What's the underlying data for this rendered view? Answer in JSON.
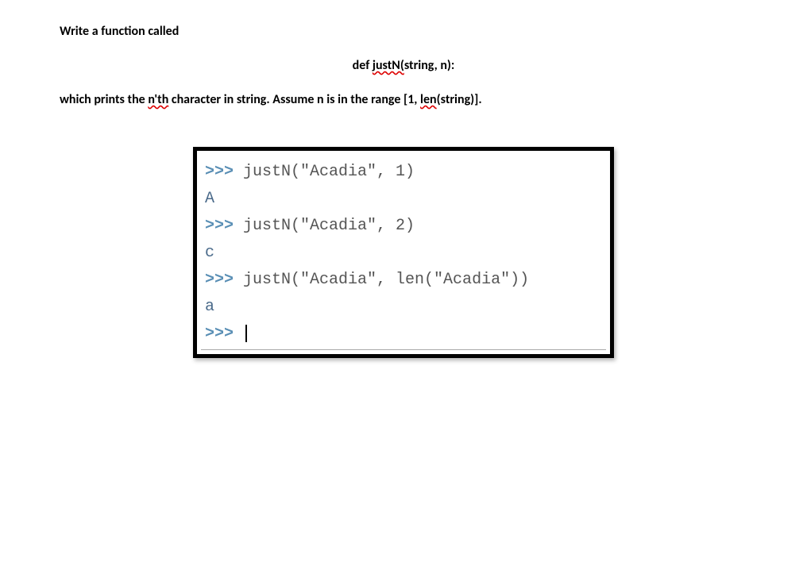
{
  "text": {
    "intro": "Write a function called",
    "def_pre": "def ",
    "def_wavy": "justN(",
    "def_post": "string, n):",
    "desc_pre": "which prints the ",
    "desc_wavy1": "n'th",
    "desc_mid": " character in string. Assume n is in the range [1, ",
    "desc_wavy2": "len",
    "desc_post": "(string)]."
  },
  "console": {
    "lines": [
      {
        "type": "in",
        "code": "justN(\"Acadia\", 1)"
      },
      {
        "type": "out",
        "code": "A"
      },
      {
        "type": "in",
        "code": "justN(\"Acadia\", 2)"
      },
      {
        "type": "out",
        "code": "c"
      },
      {
        "type": "in",
        "code": "justN(\"Acadia\", len(\"Acadia\"))"
      },
      {
        "type": "out",
        "code": "a"
      }
    ],
    "prompt": ">>> "
  }
}
